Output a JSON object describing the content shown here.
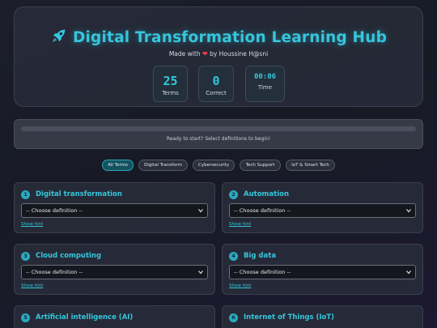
{
  "header": {
    "title": "Digital Transformation Learning Hub",
    "credit_prefix": "Made with",
    "credit_suffix": "by Houssine H@sni",
    "icons": {
      "title": "rocket-icon",
      "credit": "heart-icon"
    }
  },
  "stats": [
    {
      "value": "25",
      "label": "Terms"
    },
    {
      "value": "0",
      "label": "Correct"
    },
    {
      "value": "00:06",
      "label": "Time"
    }
  ],
  "progress": {
    "fraction": 0,
    "message": "Ready to start? Select definitions to begin!"
  },
  "filters": [
    {
      "label": "All Terms",
      "active": true
    },
    {
      "label": "Digital Transform",
      "active": false
    },
    {
      "label": "Cybersecurity",
      "active": false
    },
    {
      "label": "Tech Support",
      "active": false
    },
    {
      "label": "IoT & Smart Tech",
      "active": false
    }
  ],
  "cards": [
    {
      "number": "1",
      "term": "Digital transformation",
      "select_value": "-- Choose definition --",
      "hint": "Show hint"
    },
    {
      "number": "2",
      "term": "Automation",
      "select_value": "-- Choose definition --",
      "hint": "Show hint"
    },
    {
      "number": "3",
      "term": "Cloud computing",
      "select_value": "-- Choose definition --",
      "hint": "Show hint"
    },
    {
      "number": "4",
      "term": "Big data",
      "select_value": "-- Choose definition --",
      "hint": "Show hint"
    },
    {
      "number": "5",
      "term": "Artificial intelligence (AI)",
      "select_value": "",
      "hint": ""
    },
    {
      "number": "6",
      "term": "Internet of Things (IoT)",
      "select_value": "",
      "hint": ""
    }
  ],
  "colors": {
    "accent": "#35c6dc",
    "heart": "#ff3b4e",
    "active_chip": "#14525e"
  }
}
